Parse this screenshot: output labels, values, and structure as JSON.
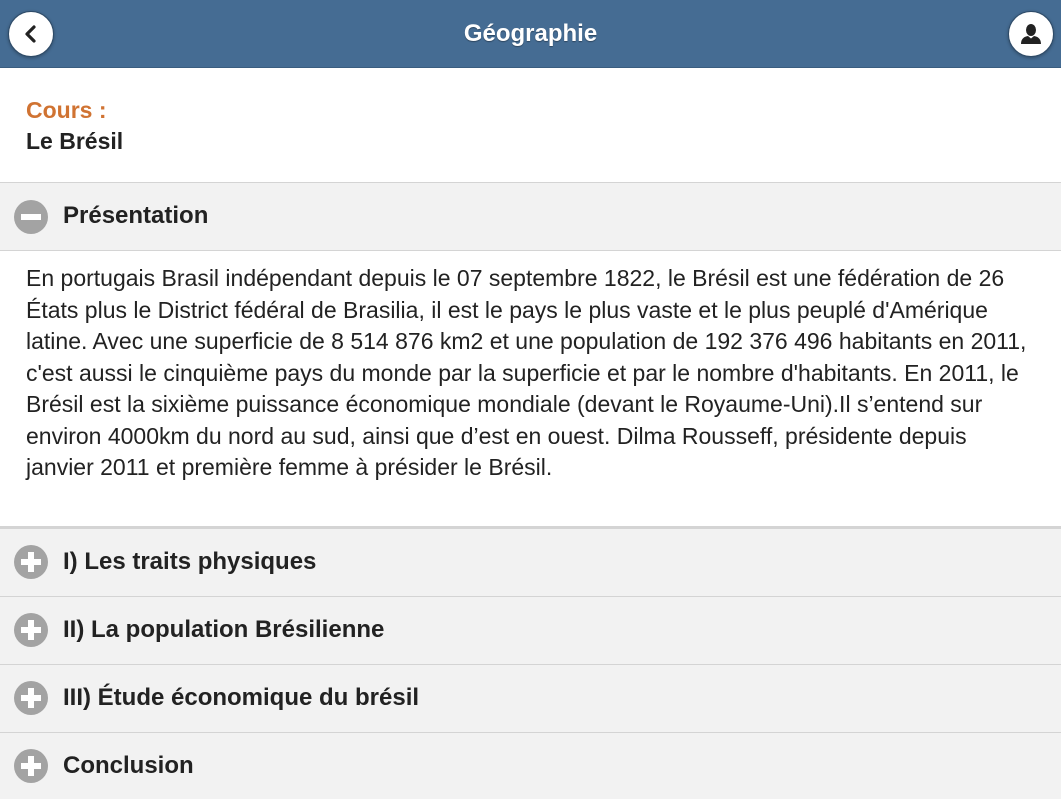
{
  "header": {
    "title": "Géographie",
    "back_icon": "chevron-left-icon",
    "user_icon": "user-icon",
    "bar_color": "#456c93"
  },
  "course": {
    "label": "Cours :",
    "name": "Le Brésil",
    "label_color": "#d07332"
  },
  "sections": [
    {
      "title": "Présentation",
      "expanded": true,
      "icon": "minus-icon",
      "content": "En portugais Brasil indépendant depuis le 07 septembre 1822, le Brésil est une fédération de 26 États plus le District fédéral de Brasilia, il est le pays le plus vaste et le plus peuplé d'Amérique latine. Avec une superficie de 8 514 876 km2 et une population de 192 376 496 habitants en 2011, c'est aussi le cinquième pays du monde par la superficie et par le nombre d'habitants. En 2011, le Brésil est la sixième puissance économique mondiale (devant le Royaume-Uni).Il s’entend sur environ 4000km du nord au sud, ainsi que d’est en ouest. Dilma Rousseff, présidente depuis janvier 2011 et première femme à présider le Brésil."
    },
    {
      "title": "I) Les traits physiques",
      "expanded": false,
      "icon": "plus-icon"
    },
    {
      "title": "II) La population Brésilienne",
      "expanded": false,
      "icon": "plus-icon"
    },
    {
      "title": "III) Étude économique du brésil",
      "expanded": false,
      "icon": "plus-icon"
    },
    {
      "title": "Conclusion",
      "expanded": false,
      "icon": "plus-icon"
    }
  ]
}
